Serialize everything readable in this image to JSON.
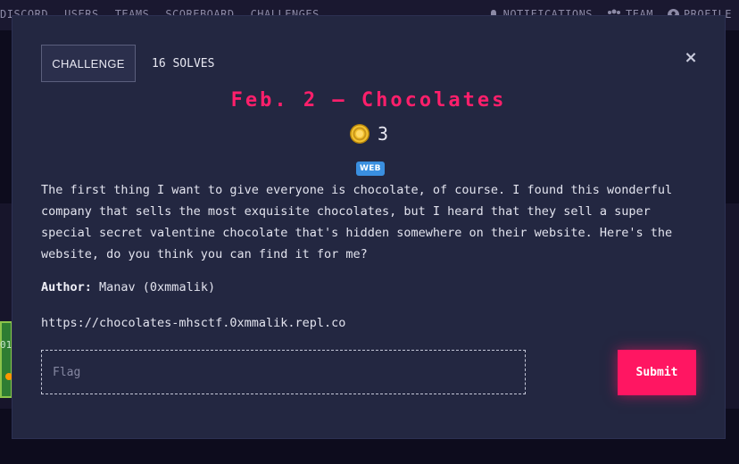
{
  "nav": {
    "left_items": [
      "DISCORD",
      "USERS",
      "TEAMS",
      "SCOREBOARD",
      "CHALLENGES"
    ],
    "notifications": "NOTIFICATIONS",
    "team": "TEAM",
    "profile": "PROFILE"
  },
  "background": {
    "card_number": "01"
  },
  "modal": {
    "tabs": {
      "challenge": "CHALLENGE",
      "solves": "16 SOLVES"
    },
    "close_label": "×",
    "title": "Feb. 2 — Chocolates",
    "points": "3",
    "tag": "WEB",
    "description": "The first thing I want to give everyone is chocolate, of course. I found this wonderful company that sells the most exquisite chocolates, but I heard that they sell a super special secret valentine chocolate that's hidden somewhere on their website. Here's the website, do you think you can find it for me?",
    "author_label": "Author:",
    "author_value": " Manav (0xmmalik)",
    "url": "https://chocolates-mhsctf.0xmmalik.repl.co",
    "flag_placeholder": "Flag",
    "submit_label": "Submit"
  },
  "colors": {
    "accent": "#ff1f6b",
    "modal_bg": "#232741",
    "tag_bg": "#3a8fe0"
  },
  "icons": [
    "bell-icon",
    "users-icon",
    "user-circle-icon",
    "coin-icon",
    "close-icon"
  ]
}
